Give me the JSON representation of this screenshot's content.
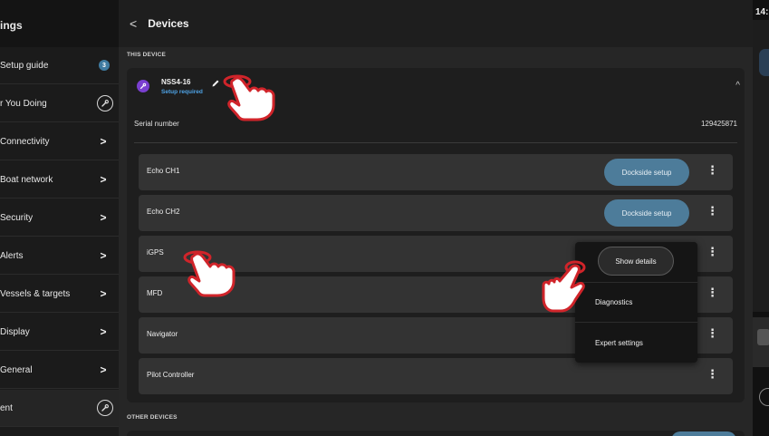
{
  "sidebar": {
    "title": "ings",
    "items": [
      {
        "label": "Setup guide",
        "badge": "3"
      },
      {
        "label": "r You Doing"
      },
      {
        "label": "Connectivity"
      },
      {
        "label": "Boat network"
      },
      {
        "label": "Security"
      },
      {
        "label": "Alerts"
      },
      {
        "label": "Vessels & targets"
      },
      {
        "label": "Display"
      },
      {
        "label": "General"
      },
      {
        "label": "ent"
      }
    ]
  },
  "header": {
    "back_glyph": "<",
    "title": "Devices"
  },
  "sections": {
    "this_device": "THIS DEVICE",
    "other_devices": "OTHER DEVICES"
  },
  "device": {
    "name": "NSS4-16",
    "status": "Setup required",
    "serial_label": "Serial number",
    "serial_value": "129425871",
    "collapse_glyph": "^"
  },
  "rows": [
    {
      "name": "Echo CH1",
      "action": "Dockside setup"
    },
    {
      "name": "Echo CH2",
      "action": "Dockside setup"
    },
    {
      "name": "iGPS"
    },
    {
      "name": "MFD"
    },
    {
      "name": "Navigator"
    },
    {
      "name": "Pilot Controller"
    }
  ],
  "menu": {
    "items": [
      "Show details",
      "Diagnostics",
      "Expert settings"
    ]
  },
  "status": {
    "clock": "14:"
  },
  "colors": {
    "accent": "#4d7c9a",
    "setup_required": "#4ea3e6",
    "device_icon": "#7a3fd0",
    "hand_outline": "#d0242a"
  }
}
